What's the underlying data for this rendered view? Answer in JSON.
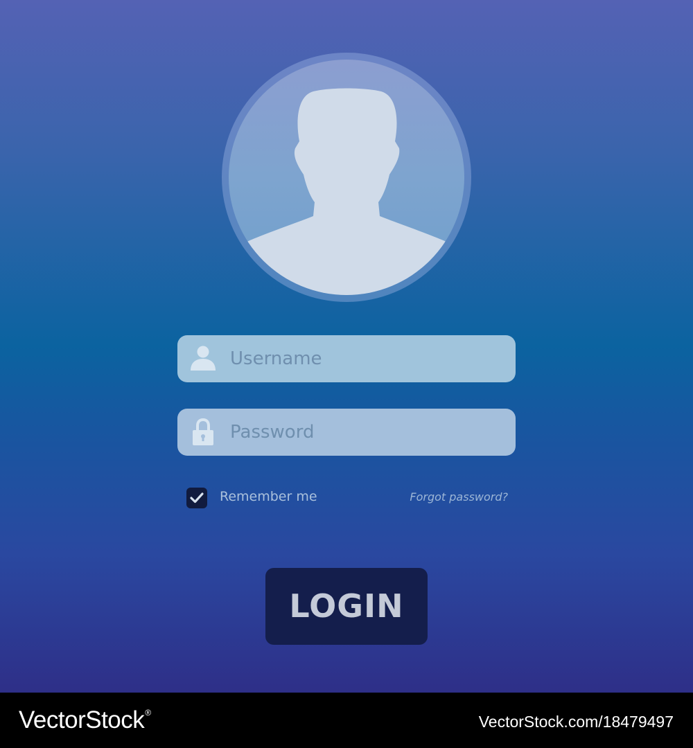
{
  "login_form": {
    "avatar_icon": "person-silhouette-icon",
    "username": {
      "icon": "user-icon",
      "placeholder": "Username",
      "value": ""
    },
    "password": {
      "icon": "padlock-icon",
      "placeholder": "Password",
      "value": ""
    },
    "remember_me": {
      "label": "Remember me",
      "checked": true,
      "icon": "checkmark-icon"
    },
    "forgot_password_label": "Forgot password?",
    "login_button_label": "LOGIN"
  },
  "watermark": {
    "brand": "VectorStock",
    "registered_mark": "®",
    "image_url_text": "VectorStock.com/18479497"
  },
  "colors": {
    "background_top": "#5462b4",
    "background_middle": "#0b63a0",
    "background_bottom": "#2e2f88",
    "field_username": "#a0c4dc",
    "field_password": "#a4bfdc",
    "button": "#141e4c",
    "button_text": "#c4cad8"
  }
}
